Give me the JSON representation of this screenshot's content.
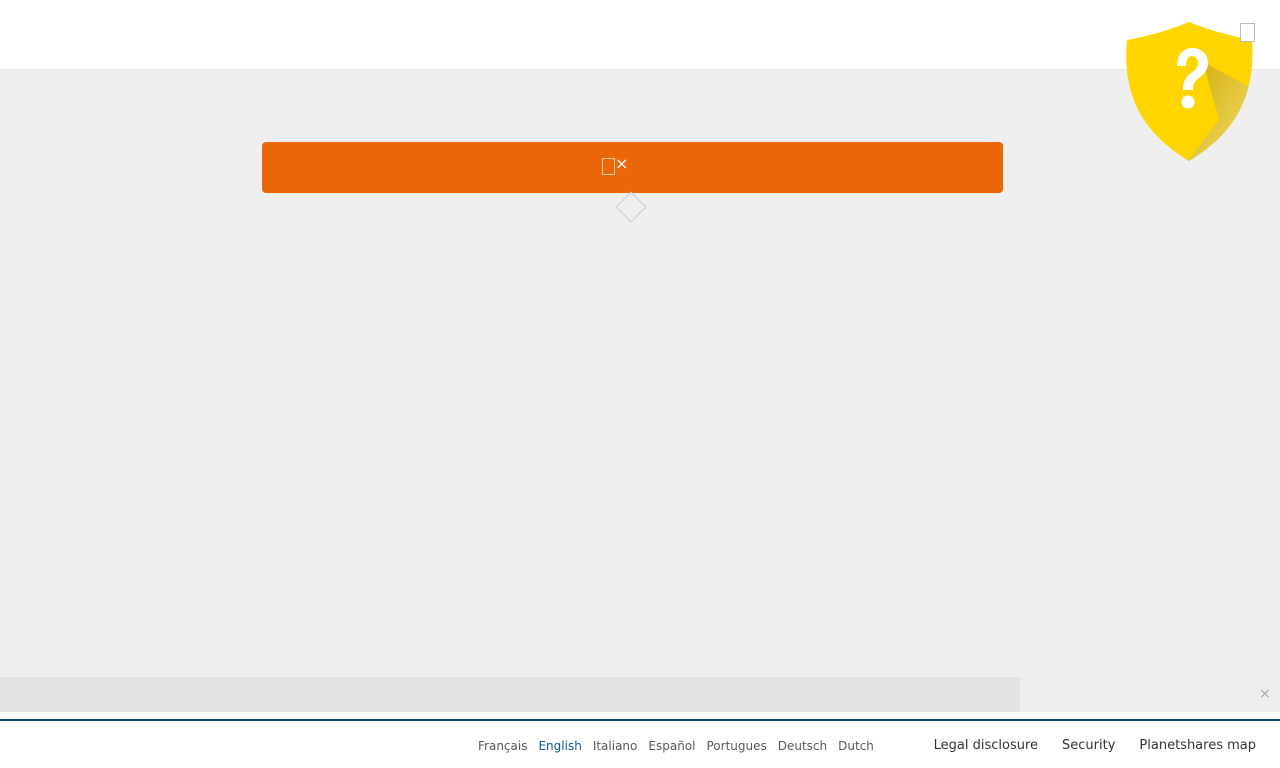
{
  "header": {
    "shield_icon": "shield-question-icon",
    "shield_color": "#ffd500"
  },
  "banner": {
    "accent_color": "#ea6609",
    "close_glyph": "×"
  },
  "notice": {
    "close_glyph": "×"
  },
  "footer": {
    "languages": [
      {
        "label": "Français",
        "active": false
      },
      {
        "label": "English",
        "active": true
      },
      {
        "label": "Italiano",
        "active": false
      },
      {
        "label": "Español",
        "active": false
      },
      {
        "label": "Portugues",
        "active": false
      },
      {
        "label": "Deutsch",
        "active": false
      },
      {
        "label": "Dutch",
        "active": false
      }
    ],
    "links": [
      {
        "label": "Legal disclosure"
      },
      {
        "label": "Security"
      },
      {
        "label": "Planetshares map"
      }
    ],
    "border_color": "#0a4a6e",
    "active_language_color": "#0b5c8a"
  }
}
